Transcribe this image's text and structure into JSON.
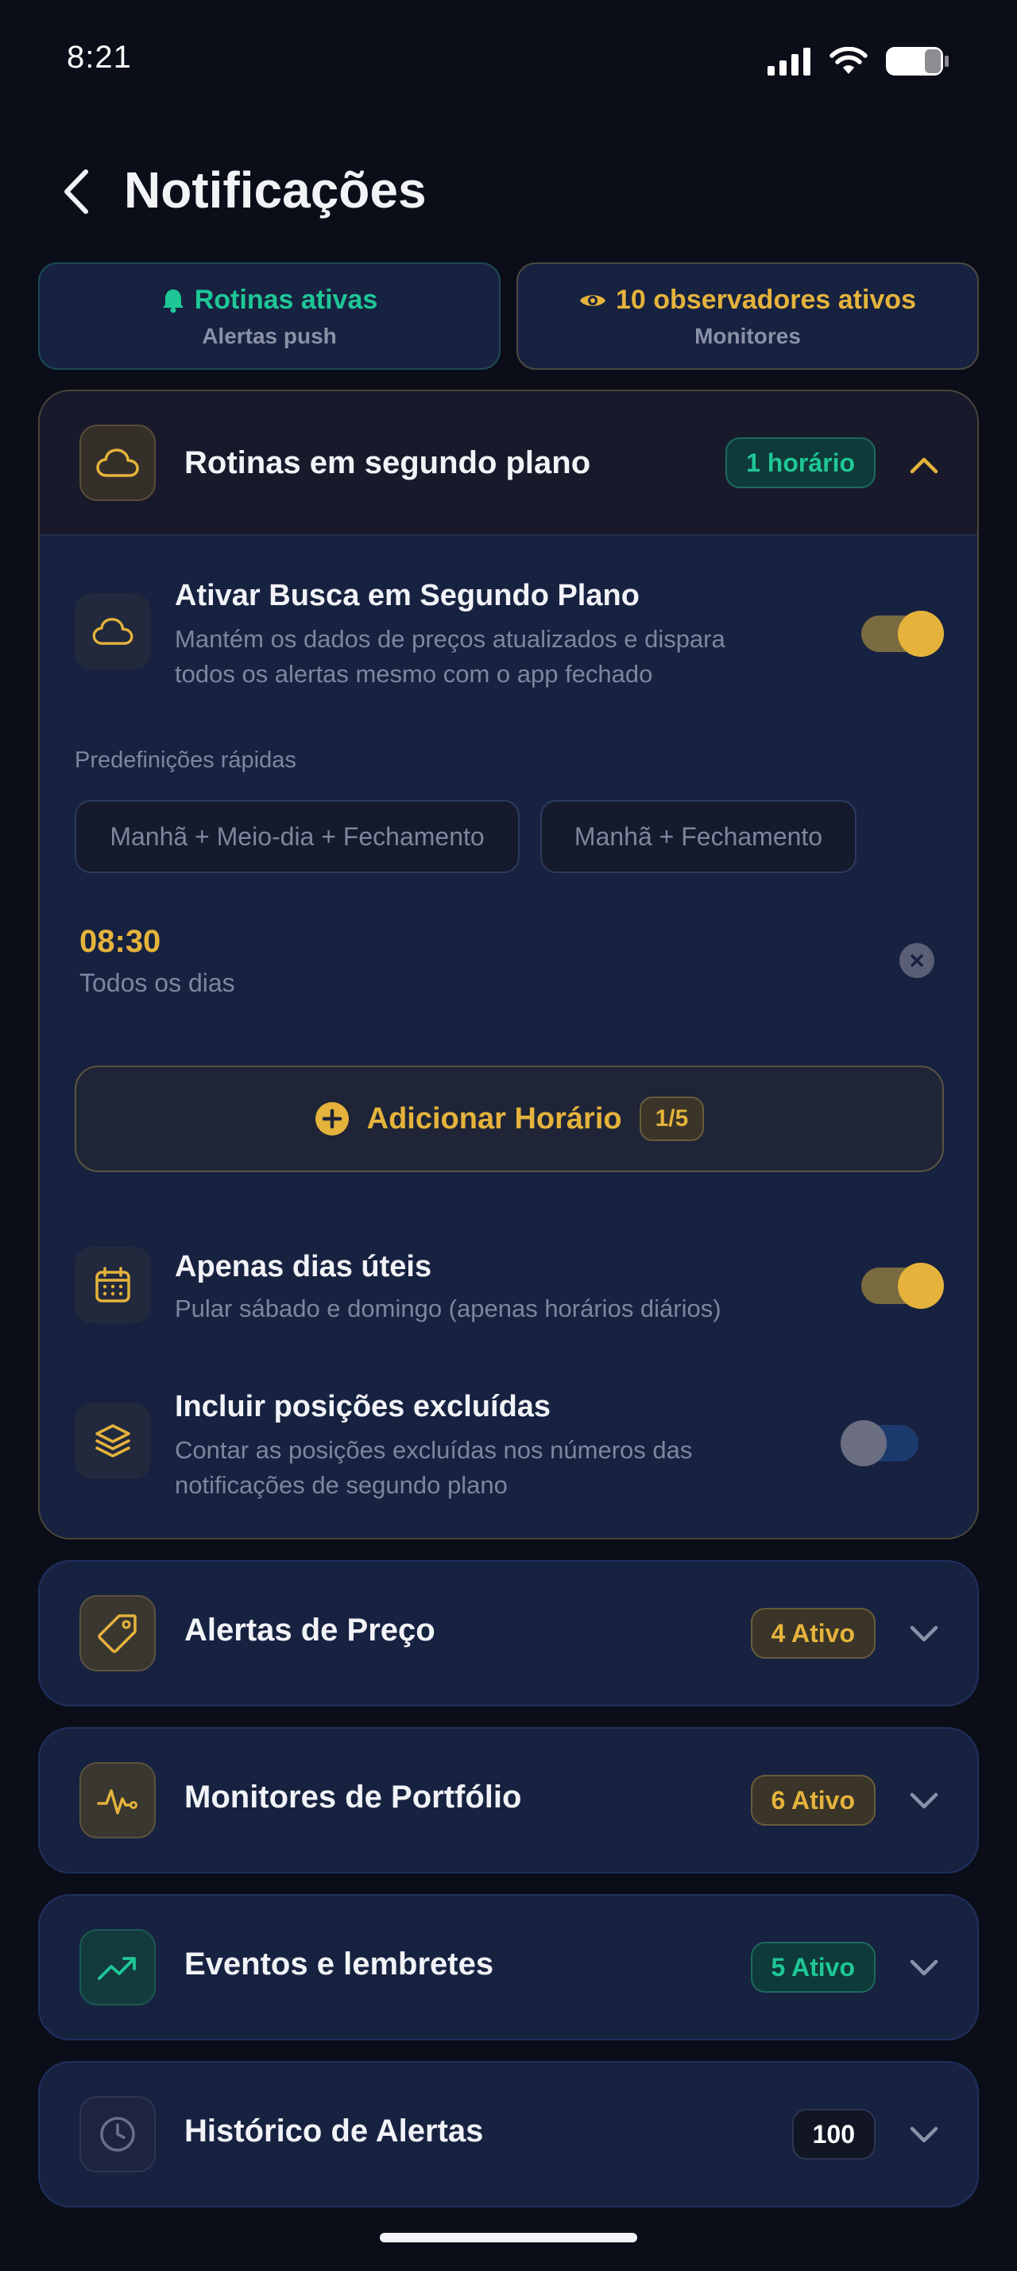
{
  "status_bar": {
    "time": "8:21"
  },
  "header": {
    "title": "Notificações"
  },
  "summary": {
    "routines": {
      "title": "Rotinas ativas",
      "subtitle": "Alertas push"
    },
    "observers": {
      "title": "10 observadores ativos",
      "subtitle": "Monitores"
    }
  },
  "background_routines": {
    "title": "Rotinas em segundo plano",
    "badge": "1 horário",
    "enable": {
      "title": "Ativar Busca em Segundo Plano",
      "description": "Mantém os dados de preços atualizados e dispara todos os alertas mesmo com o app fechado",
      "enabled": true
    },
    "presets_label": "Predefinições rápidas",
    "presets": [
      "Manhã + Meio-dia + Fechamento",
      "Manhã + Fechamento"
    ],
    "schedule": {
      "time": "08:30",
      "repeat": "Todos os dias"
    },
    "add_time": {
      "label": "Adicionar Horário",
      "count": "1/5"
    },
    "weekdays_only": {
      "title": "Apenas dias úteis",
      "description": "Pular sábado e domingo (apenas horários diários)",
      "enabled": true
    },
    "include_excluded": {
      "title": "Incluir posições excluídas",
      "description": "Contar as posições excluídas nos números das notificações de segundo plano",
      "enabled": false
    }
  },
  "sections": [
    {
      "title": "Alertas de Preço",
      "badge": "4 Ativo",
      "icon": "tag-icon"
    },
    {
      "title": "Monitores de Portfólio",
      "badge": "6 Ativo",
      "icon": "pulse-icon"
    },
    {
      "title": "Eventos e lembretes",
      "badge": "5 Ativo",
      "icon": "trending-up-icon"
    },
    {
      "title": "Histórico de Alertas",
      "badge": "100",
      "icon": "clock-icon"
    }
  ],
  "colors": {
    "accent": "#e5b33c",
    "success": "#1fc796",
    "background": "#0b0e18",
    "card": "#172240"
  }
}
